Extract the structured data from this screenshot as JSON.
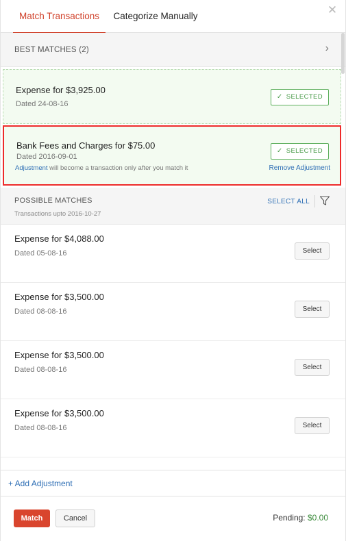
{
  "tabs": [
    {
      "label": "Match Transactions",
      "active": true
    },
    {
      "label": "Categorize Manually",
      "active": false
    }
  ],
  "best_matches": {
    "header": "BEST MATCHES (2)",
    "items": [
      {
        "title": "Expense for $3,925.00",
        "date": "Dated 24-08-16",
        "button": "SELECTED"
      },
      {
        "title": "Bank Fees and Charges for $75.00",
        "date": "Dated 2016-09-01",
        "button": "SELECTED",
        "note_link": "Adjustment",
        "note_text": " will become a transaction only after you match it",
        "remove_label": "Remove Adjustment"
      }
    ]
  },
  "possible_matches": {
    "header": "POSSIBLE MATCHES",
    "subheader": "Transactions upto 2016-10-27",
    "select_all": "SELECT ALL",
    "items": [
      {
        "title": "Expense for $4,088.00",
        "date": "Dated 05-08-16",
        "button": "Select"
      },
      {
        "title": "Expense for $3,500.00",
        "date": "Dated 08-08-16",
        "button": "Select"
      },
      {
        "title": "Expense for $3,500.00",
        "date": "Dated 08-08-16",
        "button": "Select"
      },
      {
        "title": "Expense for $3,500.00",
        "date": "Dated 08-08-16",
        "button": "Select"
      }
    ]
  },
  "add_adjustment": "+ Add Adjustment",
  "footer": {
    "match_label": "Match",
    "cancel_label": "Cancel",
    "pending_label": "Pending:",
    "pending_amount": "$0.00"
  },
  "colors": {
    "accent": "#d0412a",
    "selected_green": "#4a9b4a",
    "link_blue": "#2f6fb5",
    "highlight_red": "#ee2a2a"
  },
  "icons": [
    "close-icon",
    "chevron-right-icon",
    "check-icon",
    "filter-icon"
  ]
}
